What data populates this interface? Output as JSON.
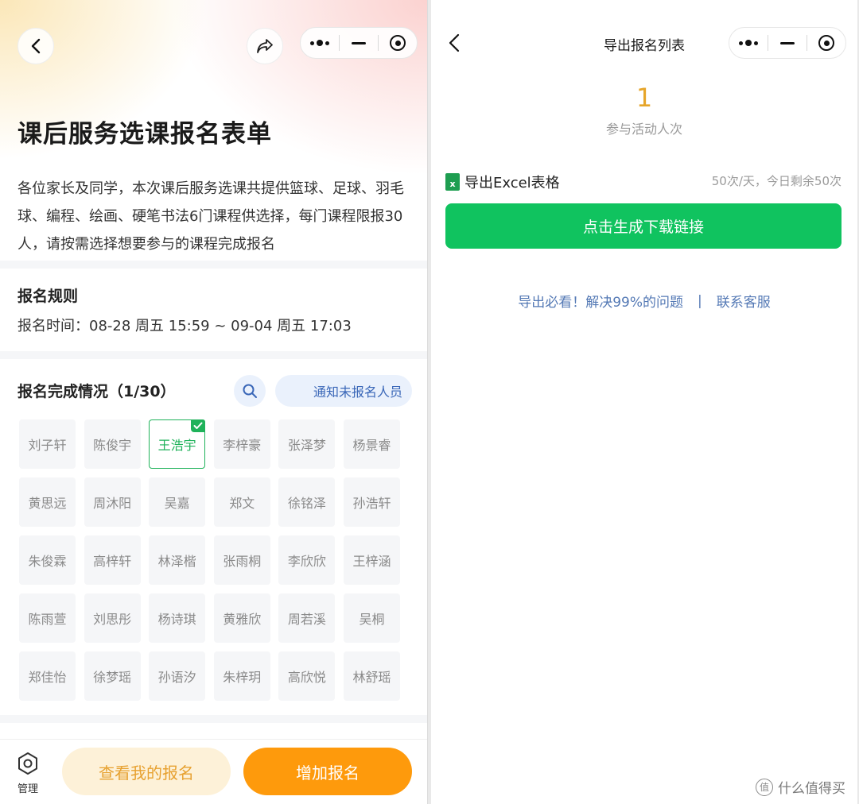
{
  "left": {
    "title": "课后服务选课报名表单",
    "description": "各位家长及同学，本次课后服务选课共提供篮球、足球、羽毛球、编程、绘画、硬笔书法6门课程供选择，每门课程限报30人，请按需选择想要参与的课程完成报名",
    "rules": {
      "title": "报名规则",
      "time": "报名时间：08-28 周五 15:59 ~ 09-04 周五 17:03"
    },
    "status": {
      "title": "报名完成情况（1/30）",
      "notify_label": "通知未报名人员"
    },
    "names": [
      {
        "name": "刘子轩",
        "selected": false
      },
      {
        "name": "陈俊宇",
        "selected": false
      },
      {
        "name": "王浩宇",
        "selected": true
      },
      {
        "name": "李梓豪",
        "selected": false
      },
      {
        "name": "张泽梦",
        "selected": false
      },
      {
        "name": "杨景睿",
        "selected": false
      },
      {
        "name": "黄思远",
        "selected": false
      },
      {
        "name": "周沐阳",
        "selected": false
      },
      {
        "name": "吴嘉",
        "selected": false
      },
      {
        "name": "郑文",
        "selected": false
      },
      {
        "name": "徐铭泽",
        "selected": false
      },
      {
        "name": "孙浩轩",
        "selected": false
      },
      {
        "name": "朱俊霖",
        "selected": false
      },
      {
        "name": "高梓轩",
        "selected": false
      },
      {
        "name": "林泽楷",
        "selected": false
      },
      {
        "name": "张雨桐",
        "selected": false
      },
      {
        "name": "李欣欣",
        "selected": false
      },
      {
        "name": "王梓涵",
        "selected": false
      },
      {
        "name": "陈雨萱",
        "selected": false
      },
      {
        "name": "刘思彤",
        "selected": false
      },
      {
        "name": "杨诗琪",
        "selected": false
      },
      {
        "name": "黄雅欣",
        "selected": false
      },
      {
        "name": "周若溪",
        "selected": false
      },
      {
        "name": "吴桐",
        "selected": false
      },
      {
        "name": "郑佳怡",
        "selected": false
      },
      {
        "name": "徐梦瑶",
        "selected": false
      },
      {
        "name": "孙语汐",
        "selected": false
      },
      {
        "name": "朱梓玥",
        "selected": false
      },
      {
        "name": "高欣悦",
        "selected": false
      },
      {
        "name": "林舒瑶",
        "selected": false
      }
    ],
    "bottom": {
      "manage_label": "管理",
      "view_label": "查看我的报名",
      "add_label": "增加报名"
    }
  },
  "right": {
    "title": "导出报名列表",
    "participants_count": "1",
    "participants_label": "参与活动人次",
    "excel_icon_letter": "x",
    "excel_label": "导出Excel表格",
    "quota": "50次/天，今日剩余50次",
    "generate_label": "点击生成下载链接",
    "help_link": "导出必看！解决99%的问题",
    "help_separator": "|",
    "contact_link": "联系客服"
  },
  "watermark": {
    "symbol": "值",
    "text": "什么值得买"
  },
  "colors": {
    "accent_orange": "#fe9a0c",
    "accent_green": "#10c35f",
    "selected_green": "#1fb25a",
    "link_blue": "#5479b5",
    "count_gold": "#e6a52a"
  }
}
